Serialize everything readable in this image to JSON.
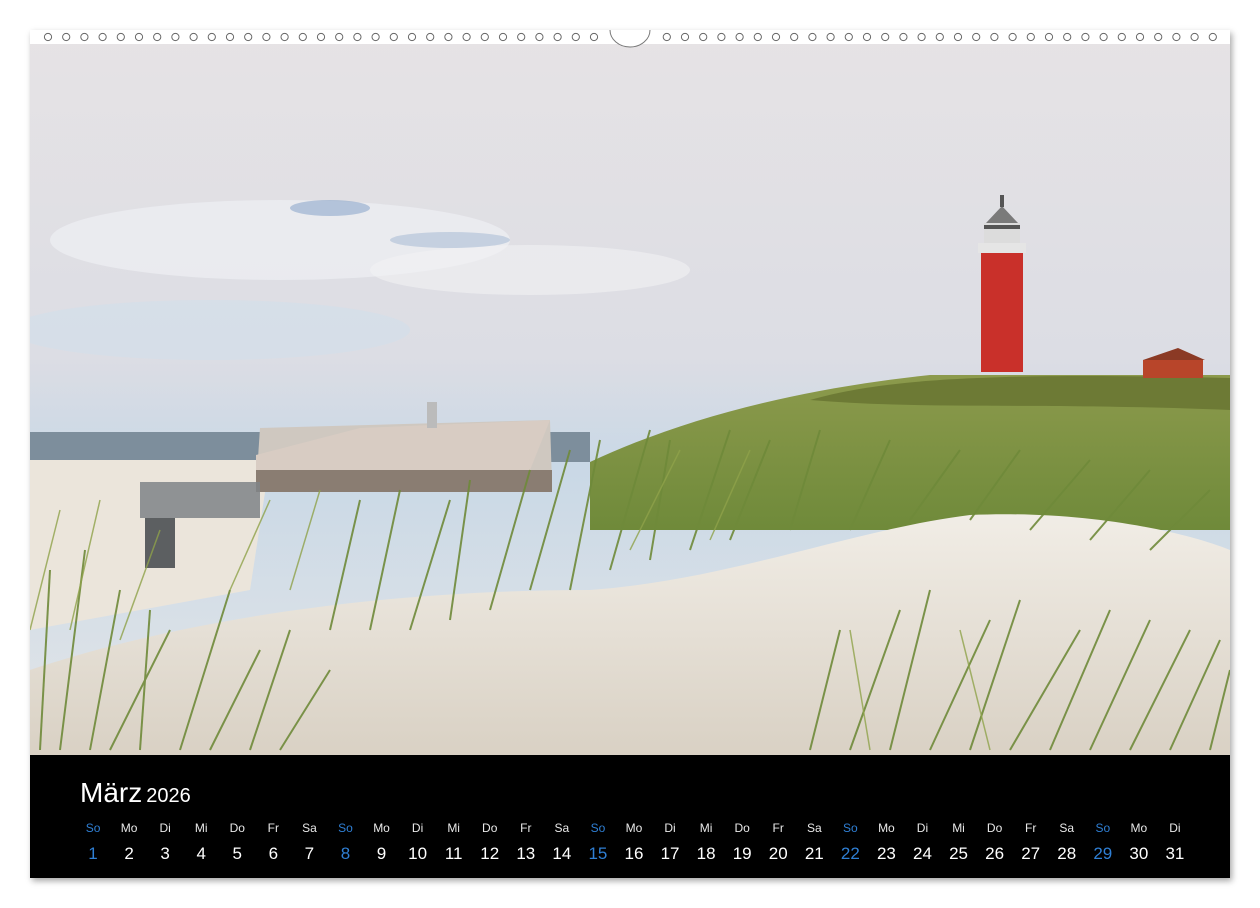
{
  "calendar": {
    "month": "März",
    "year": "2026",
    "weekday_color_sunday": "#2f7fd4",
    "days": [
      {
        "dn": "So",
        "d": "1",
        "sun": true
      },
      {
        "dn": "Mo",
        "d": "2"
      },
      {
        "dn": "Di",
        "d": "3"
      },
      {
        "dn": "Mi",
        "d": "4"
      },
      {
        "dn": "Do",
        "d": "5"
      },
      {
        "dn": "Fr",
        "d": "6"
      },
      {
        "dn": "Sa",
        "d": "7"
      },
      {
        "dn": "So",
        "d": "8",
        "sun": true
      },
      {
        "dn": "Mo",
        "d": "9"
      },
      {
        "dn": "Di",
        "d": "10"
      },
      {
        "dn": "Mi",
        "d": "11"
      },
      {
        "dn": "Do",
        "d": "12"
      },
      {
        "dn": "Fr",
        "d": "13"
      },
      {
        "dn": "Sa",
        "d": "14"
      },
      {
        "dn": "So",
        "d": "15",
        "sun": true
      },
      {
        "dn": "Mo",
        "d": "16"
      },
      {
        "dn": "Di",
        "d": "17"
      },
      {
        "dn": "Mi",
        "d": "18"
      },
      {
        "dn": "Do",
        "d": "19"
      },
      {
        "dn": "Fr",
        "d": "20"
      },
      {
        "dn": "Sa",
        "d": "21"
      },
      {
        "dn": "So",
        "d": "22",
        "sun": true
      },
      {
        "dn": "Mo",
        "d": "23"
      },
      {
        "dn": "Di",
        "d": "24"
      },
      {
        "dn": "Mi",
        "d": "25"
      },
      {
        "dn": "Do",
        "d": "26"
      },
      {
        "dn": "Fr",
        "d": "27"
      },
      {
        "dn": "Sa",
        "d": "28"
      },
      {
        "dn": "So",
        "d": "29",
        "sun": true
      },
      {
        "dn": "Mo",
        "d": "30"
      },
      {
        "dn": "Di",
        "d": "31"
      }
    ]
  },
  "photo": {
    "lighthouse_color": "#c9302a",
    "sky_color": "#dfe6ee",
    "dune_color": "#e9e3d8",
    "grass_color": "#7a9a3a"
  }
}
